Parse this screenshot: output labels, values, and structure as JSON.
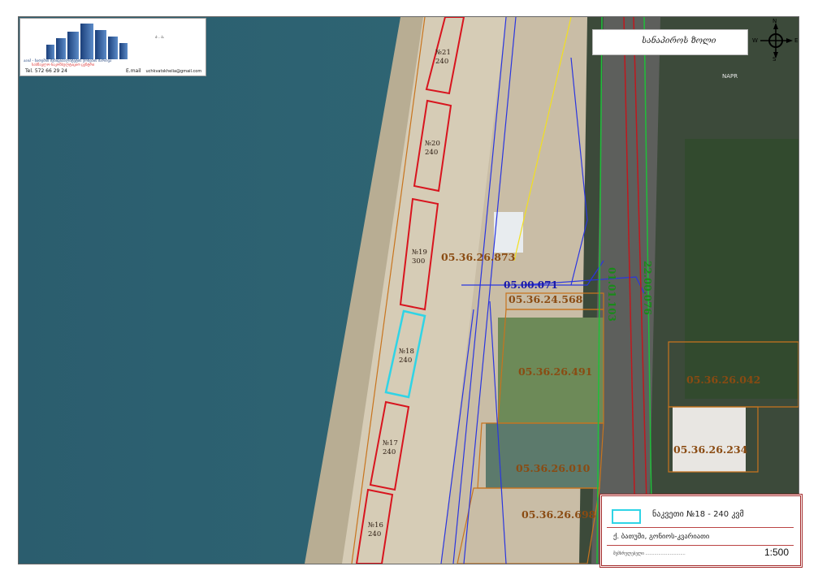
{
  "logo": {
    "line1": "ააიპ - ბათუმის მუნიციპალიტეტის ქონების მართვა",
    "line2": "სასწავლო-საკონსულტაციო ცენტრი",
    "corner_text": "ა . ა.",
    "tel": "Tel.   572 66 29 24",
    "email_label": "E.mail",
    "email": "uchkvatskhelia@gmail.com"
  },
  "title": "სანაპიროს ზოლი",
  "compass": {
    "n": "N",
    "s": "S",
    "e": "E",
    "w": "W"
  },
  "map": {
    "parcels": [
      "05.36.26.873",
      "05.36.24.568",
      "05.36.26.491",
      "05.36.26.042",
      "05.36.26.234",
      "05.36.26.010",
      "05.36.26.698"
    ],
    "roads": {
      "blue": "05.00.071",
      "green1": "01.01.103",
      "green2": "22.00.076"
    },
    "lots": [
      {
        "no": "№21",
        "area": "240"
      },
      {
        "no": "№20",
        "area": "240"
      },
      {
        "no": "№19",
        "area": "300"
      },
      {
        "no": "№18",
        "area": "240"
      },
      {
        "no": "№17",
        "area": "240"
      },
      {
        "no": "№16",
        "area": "240"
      }
    ],
    "corner_tag": "NAPR"
  },
  "legend": {
    "description": "ნაკვეთი №18 - 240 კვმ",
    "address": "ქ. ბათუმი, გონიოს-კვარიათი",
    "signature": "შემსრულებელი ...............................",
    "scale": "1:500"
  },
  "colors": {
    "sea": "#2f5f6e",
    "beach": "#d9cfbc",
    "lot_outline": "#d8141e",
    "selected_lot": "#2fd4e6",
    "parcel_outline": "#c8741e",
    "road_blue": "#2a35e0",
    "road_green": "#1fbf3a"
  }
}
